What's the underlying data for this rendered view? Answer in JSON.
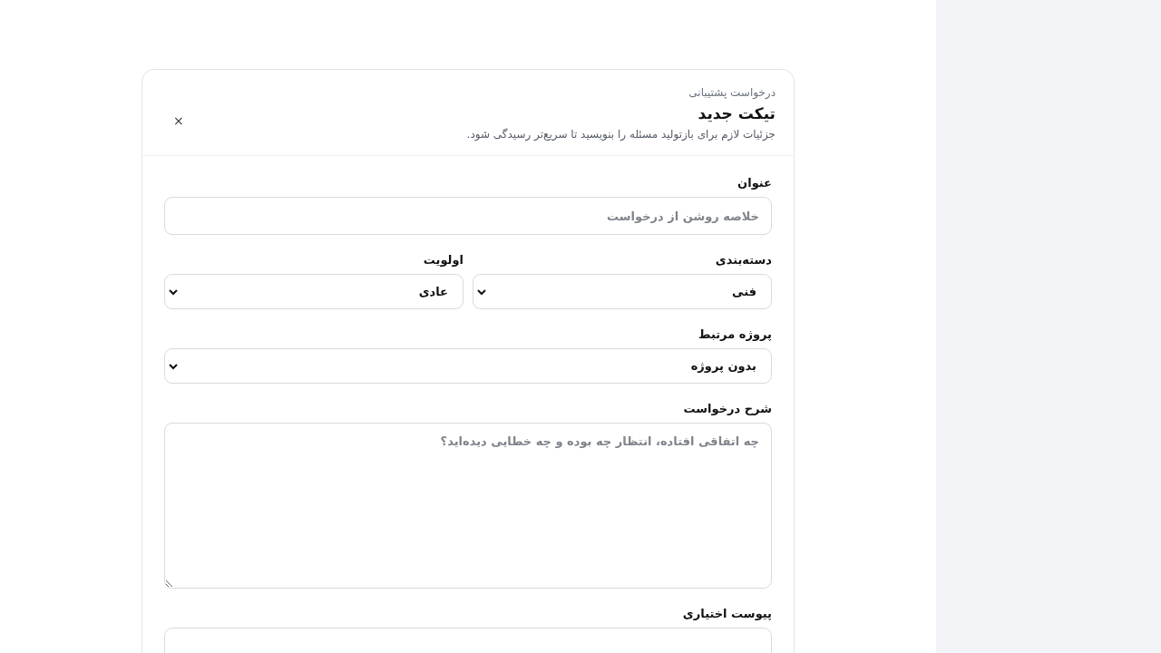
{
  "header": {
    "eyebrow": "درخواست پشتیبانی",
    "title": "تیکت جدید",
    "subtitle": "جزئیات لازم برای بازتولید مسئله را بنویسید تا سریع‌تر رسیدگی شود.",
    "close": "×"
  },
  "rows": [
    [
      {
        "kind": "text",
        "label": "عنوان",
        "placeholder": "خلاصه روشن از درخواست"
      }
    ],
    [
      {
        "kind": "select",
        "label": "دسته‌بندی",
        "value": "فنی"
      },
      {
        "kind": "select",
        "label": "اولویت",
        "value": "عادی"
      }
    ],
    [
      {
        "kind": "select",
        "label": "پروژه مرتبط",
        "value": "بدون پروژه"
      }
    ],
    [
      {
        "kind": "textarea",
        "label": "شرح درخواست",
        "placeholder": "چه اتفاقی افتاده، انتظار چه بوده و چه خطایی دیده‌اید؟"
      }
    ],
    [
      {
        "kind": "file",
        "label": "پیوست اختیاری"
      }
    ]
  ]
}
